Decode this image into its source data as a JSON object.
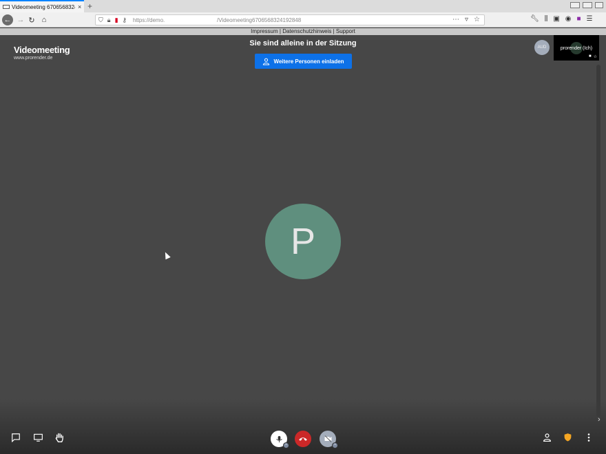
{
  "browser": {
    "tab_title": "Videomeeting 6706568324192848",
    "tab_close": "×",
    "new_tab": "+",
    "url_host": "https://demo.",
    "url_path": "/Videomeeting6706568324192848",
    "accent_color": "#0a84ff"
  },
  "legal": {
    "text": "Impressum | Datenschutzhinweis | Support"
  },
  "meeting": {
    "brand_title": "Videomeeting",
    "brand_url": "www.prorender.de",
    "alone_message": "Sie sind alleine in der Sitzung",
    "invite_label": "Weitere Personen einladen",
    "invite_color": "#0d71e8",
    "aud_initials": "AUD",
    "self_name": "prorender (Ich)",
    "participant_initial": "P",
    "participant_color": "#5f8f7e"
  },
  "toolbar": {
    "hangup_color": "#cb2828",
    "security_color": "#f5a623",
    "icons": [
      "chat-icon",
      "screen-share-icon",
      "raise-hand-icon",
      "microphone-icon",
      "hangup-icon",
      "camera-off-icon",
      "invite-person-icon",
      "security-shield-icon",
      "more-options-icon"
    ]
  }
}
